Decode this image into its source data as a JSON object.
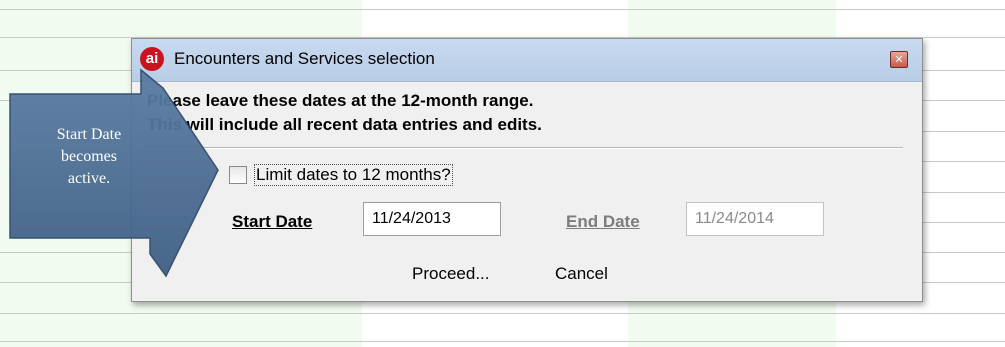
{
  "dialog": {
    "title": "Encounters and Services selection",
    "app_icon_text": "ai",
    "close_glyph": "✕",
    "message_line1": "Please leave these dates at the 12-month range.",
    "message_line2": "This will include all recent data entries and edits.",
    "limit_checkbox_label": "Limit dates to 12 months?",
    "limit_checked": false,
    "start_date_label": "Start Date",
    "start_date_value": "11/24/2013",
    "end_date_label": "End Date",
    "end_date_value": "11/24/2014",
    "proceed_label": "Proceed...",
    "cancel_label": "Cancel"
  },
  "callout": {
    "line1": "Start Date",
    "line2": "becomes",
    "line3": "active.",
    "fill_color": "#4e6f95"
  },
  "colors": {
    "titlebar": "#c4d7ee",
    "dialog_bg": "#f0f0f0",
    "app_icon": "#c8141e",
    "band": "#f1fbef"
  }
}
